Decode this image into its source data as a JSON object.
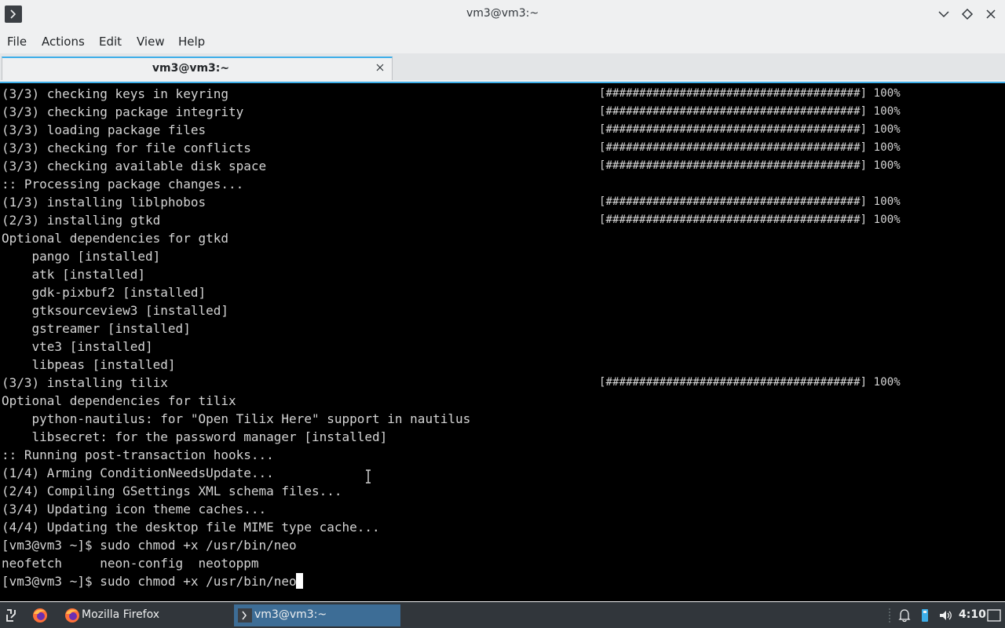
{
  "window": {
    "title": "vm3@vm3:~"
  },
  "menu": [
    "File",
    "Actions",
    "Edit",
    "View",
    "Help"
  ],
  "tab": {
    "label": "vm3@vm3:~"
  },
  "terminal": {
    "lines": [
      {
        "text": "(3/3) checking keys in keyring",
        "bar": "[######################################] 100%"
      },
      {
        "text": "(3/3) checking package integrity",
        "bar": "[######################################] 100%"
      },
      {
        "text": "(3/3) loading package files",
        "bar": "[######################################] 100%"
      },
      {
        "text": "(3/3) checking for file conflicts",
        "bar": "[######################################] 100%"
      },
      {
        "text": "(3/3) checking available disk space",
        "bar": "[######################################] 100%"
      },
      {
        "text": ":: Processing package changes...",
        "bar": ""
      },
      {
        "text": "(1/3) installing liblphobos",
        "bar": "[######################################] 100%"
      },
      {
        "text": "(2/3) installing gtkd",
        "bar": "[######################################] 100%"
      },
      {
        "text": "Optional dependencies for gtkd",
        "bar": ""
      },
      {
        "text": "    pango [installed]",
        "bar": ""
      },
      {
        "text": "    atk [installed]",
        "bar": ""
      },
      {
        "text": "    gdk-pixbuf2 [installed]",
        "bar": ""
      },
      {
        "text": "    gtksourceview3 [installed]",
        "bar": ""
      },
      {
        "text": "    gstreamer [installed]",
        "bar": ""
      },
      {
        "text": "    vte3 [installed]",
        "bar": ""
      },
      {
        "text": "    libpeas [installed]",
        "bar": ""
      },
      {
        "text": "(3/3) installing tilix",
        "bar": "[######################################] 100%"
      },
      {
        "text": "Optional dependencies for tilix",
        "bar": ""
      },
      {
        "text": "    python-nautilus: for \"Open Tilix Here\" support in nautilus",
        "bar": ""
      },
      {
        "text": "    libsecret: for the password manager [installed]",
        "bar": ""
      },
      {
        "text": ":: Running post-transaction hooks...",
        "bar": ""
      },
      {
        "text": "(1/4) Arming ConditionNeedsUpdate...",
        "bar": ""
      },
      {
        "text": "(2/4) Compiling GSettings XML schema files...",
        "bar": ""
      },
      {
        "text": "(3/4) Updating icon theme caches...",
        "bar": ""
      },
      {
        "text": "(4/4) Updating the desktop file MIME type cache...",
        "bar": ""
      },
      {
        "text": "[vm3@vm3 ~]$ sudo chmod +x /usr/bin/neo",
        "bar": ""
      },
      {
        "text": "neofetch     neon-config  neotoppm",
        "bar": ""
      },
      {
        "text": "[vm3@vm3 ~]$ sudo chmod +x /usr/bin/neo",
        "bar": ""
      }
    ]
  },
  "taskbar": {
    "tasks": [
      {
        "label": "Mozilla Firefox",
        "active": false
      },
      {
        "label": "vm3@vm3:~",
        "active": true
      }
    ],
    "clock": "4:10"
  },
  "colors": {
    "accent": "#3daee9",
    "terminal_bg": "#000000",
    "terminal_fg": "#d4d4d4",
    "taskbar_bg": "#31363b"
  }
}
